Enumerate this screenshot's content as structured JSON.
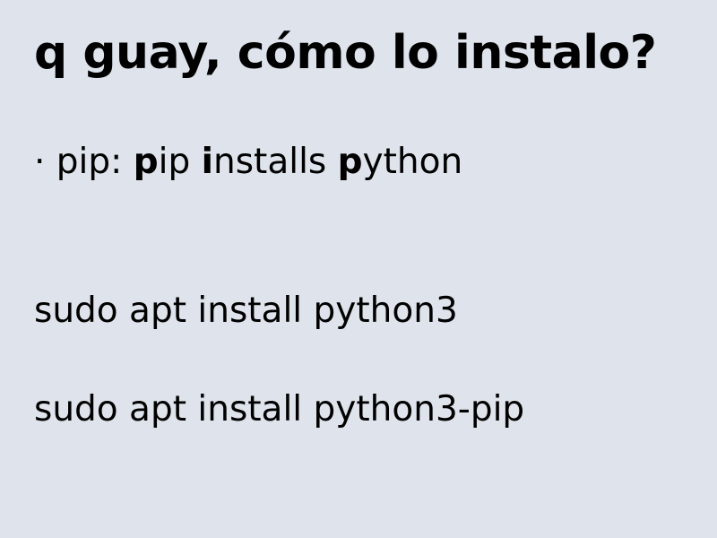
{
  "slide": {
    "title": "q guay, cómo lo instalo?",
    "bullet": {
      "marker": "· ",
      "term": "pip",
      "separator": ": ",
      "parts": [
        {
          "bold": "p",
          "rest": "ip "
        },
        {
          "bold": "i",
          "rest": "nstalls "
        },
        {
          "bold": "p",
          "rest": "ython"
        }
      ]
    },
    "commands": [
      "sudo apt install python3",
      "sudo apt install python3-pip"
    ]
  },
  "colors": {
    "background": "#dfe4ec",
    "text": "#000000"
  }
}
